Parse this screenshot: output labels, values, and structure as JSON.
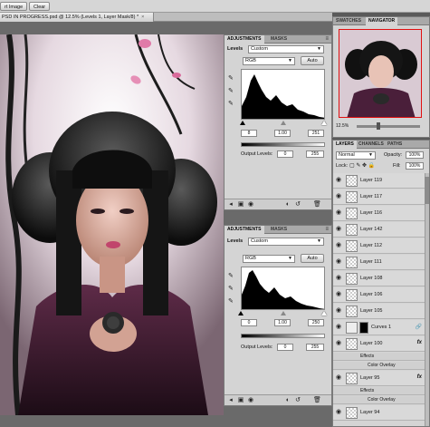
{
  "topbar": {
    "left_button": "rt Image",
    "clear_button": "Clear"
  },
  "document": {
    "title": "PSD IN PROGRESS.psd @ 12.5% (Levels 1, Layer Mask/8) *",
    "close": "×"
  },
  "adjustments_panel_1": {
    "tabs": [
      "ADJUSTMENTS",
      "MASKS"
    ],
    "preset_label": "Levels",
    "preset_value": "Custom",
    "channel": "RGB",
    "auto_label": "Auto",
    "input_black": "8",
    "input_gamma": "1.00",
    "input_white": "251",
    "output_label": "Output Levels:",
    "output_black": "0",
    "output_white": "255"
  },
  "adjustments_panel_2": {
    "tabs": [
      "ADJUSTMENTS",
      "MASKS"
    ],
    "preset_label": "Levels",
    "preset_value": "Custom",
    "channel": "RGB",
    "auto_label": "Auto",
    "input_black": "0",
    "input_gamma": "1.00",
    "input_white": "250",
    "output_label": "Output Levels:",
    "output_black": "0",
    "output_white": "255"
  },
  "navigator_panel": {
    "tabs": [
      "SWATCHES",
      "NAVIGATOR"
    ],
    "zoom": "12.5%"
  },
  "layers_panel": {
    "tabs": [
      "LAYERS",
      "CHANNELS",
      "PATHS"
    ],
    "blend_mode": "Normal",
    "opacity_label": "Opacity:",
    "opacity_value": "100%",
    "lock_label": "Lock:",
    "fill_label": "Fill:",
    "fill_value": "100%",
    "layers": [
      {
        "name": "Layer 119"
      },
      {
        "name": "Layer 117"
      },
      {
        "name": "Layer 116"
      },
      {
        "name": "Layer 142"
      },
      {
        "name": "Layer 112"
      },
      {
        "name": "Layer 111"
      },
      {
        "name": "Layer 108"
      },
      {
        "name": "Layer 106"
      },
      {
        "name": "Layer 105"
      },
      {
        "name": "Curves 1"
      },
      {
        "name": "Layer 100",
        "effects_label": "Effects",
        "effect": "Color Overlay"
      },
      {
        "name": "Layer 95",
        "effects_label": "Effects",
        "effect": "Color Overlay"
      },
      {
        "name": "Layer 94"
      }
    ]
  },
  "colors": {
    "panel": "#d4d4d4",
    "panel_tab": "#a9a9a9",
    "nav_frame": "#e01010",
    "pink_accent": "#e07aa8"
  }
}
